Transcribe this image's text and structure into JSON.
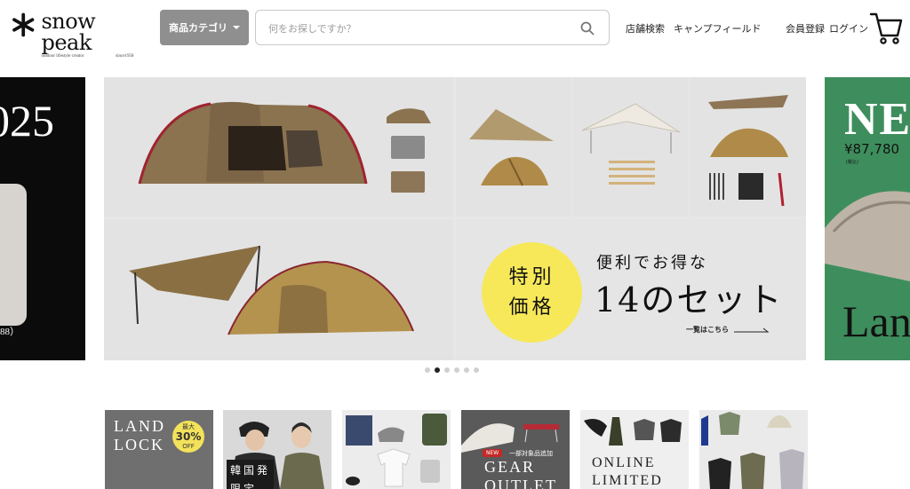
{
  "header": {
    "logo": {
      "name": "snow peak",
      "sub_left": "outdoor lifestyle creator",
      "sub_right": "since1958"
    },
    "category_button": "商品カテゴリ",
    "search": {
      "placeholder": "何をお探しですか？",
      "value": ""
    },
    "nav": [
      "店舗検索",
      "キャンプフィールド",
      "会員登録",
      "ログイン"
    ]
  },
  "carousel": {
    "prev_slide": {
      "headline": "025",
      "code": "88）"
    },
    "main_slide": {
      "badge": [
        "特別",
        "価格"
      ],
      "subtitle": "便利でお得な",
      "title": "14のセット",
      "link": "一覧はこちら"
    },
    "next_slide": {
      "headline": "NE",
      "price": "¥87,780",
      "tax": "(税込)",
      "name": "Lan"
    },
    "dots": {
      "count": 6,
      "active": 1
    }
  },
  "cards": [
    {
      "title": "LAND\nLOCK",
      "badge_top": "最大",
      "badge_pct": "30%",
      "badge_bottom": "OFF"
    },
    {
      "title": "韓国発\n限定"
    },
    {
      "title": ""
    },
    {
      "title": "GEAR\nOUTLET",
      "tag": "NEW",
      "tag_sub": "一部対象品追加"
    },
    {
      "title": "ONLINE\nLIMITED"
    },
    {
      "title": ""
    }
  ],
  "colors": {
    "accent_yellow": "#f7e859",
    "category_button": "#8f8f8f",
    "next_slide_bg": "#3e8e5d"
  }
}
